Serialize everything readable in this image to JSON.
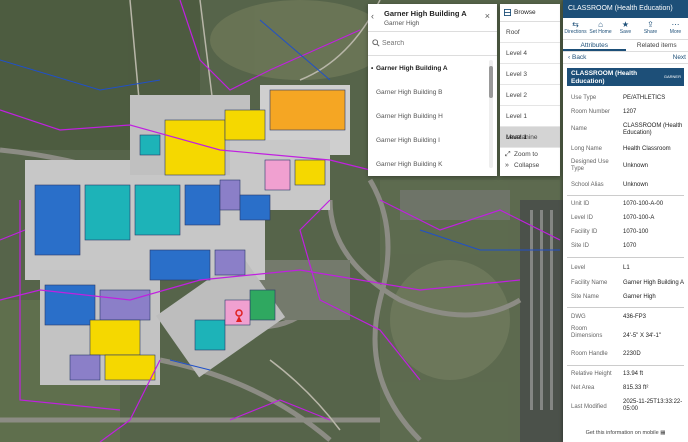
{
  "facility_picker": {
    "title": "Garner High Building A",
    "subtitle": "Garner High",
    "search_placeholder": "Search",
    "items": [
      {
        "label": "Garner High Building A",
        "selected": true
      },
      {
        "label": "Garner High Building B",
        "selected": false
      },
      {
        "label": "Garner High Building H",
        "selected": false
      },
      {
        "label": "Garner High Building I",
        "selected": false
      },
      {
        "label": "Garner High Building K",
        "selected": false
      }
    ]
  },
  "level_selector": {
    "browse_label": "Browse",
    "levels": [
      "Roof",
      "Level 4",
      "Level 3",
      "Level 2",
      "Level 1 Mezzanine",
      "Level 1"
    ],
    "active_level": "Level 1",
    "zoom_label": "Zoom to",
    "collapse_label": "Collapse"
  },
  "panel": {
    "header": "CLASSROOM (Health Education)",
    "tools": [
      {
        "icon": "directions-icon",
        "label": "Directions"
      },
      {
        "icon": "home-icon",
        "label": "Set Home"
      },
      {
        "icon": "star-icon",
        "label": "Save"
      },
      {
        "icon": "share-icon",
        "label": "Share"
      },
      {
        "icon": "more-icon",
        "label": "More"
      }
    ],
    "tabs": [
      "Attributes",
      "Related items"
    ],
    "back_label": "Back",
    "next_label": "Next",
    "feature_title": "CLASSROOM (Health Education)",
    "logo_text": "GARNER",
    "attributes_group1": [
      {
        "key": "Use Type",
        "value": "PE/ATHLETICS"
      },
      {
        "key": "Room Number",
        "value": "1207"
      },
      {
        "key": "Name",
        "value": "CLASSROOM (Health Education)"
      },
      {
        "key": "Long Name",
        "value": "Health Classroom"
      },
      {
        "key": "Designed Use Type",
        "value": "Unknown"
      },
      {
        "key": "School Alias",
        "value": "Unknown"
      }
    ],
    "attributes_group2": [
      {
        "key": "Unit ID",
        "value": "1070-100-A-00"
      },
      {
        "key": "Level ID",
        "value": "1070-100-A"
      },
      {
        "key": "Facility ID",
        "value": "1070-100"
      },
      {
        "key": "Site ID",
        "value": "1070"
      }
    ],
    "attributes_group3": [
      {
        "key": "Level",
        "value": "L1"
      },
      {
        "key": "Facility Name",
        "value": "Garner High Building A"
      },
      {
        "key": "Site Name",
        "value": "Garner High"
      }
    ],
    "attributes_group4": [
      {
        "key": "DWG",
        "value": "436-FP3"
      },
      {
        "key": "Room Dimensions",
        "value": "24'-5\" X 34'-1\""
      },
      {
        "key": "Room Handle",
        "value": "2230D"
      }
    ],
    "attributes_group5": [
      {
        "key": "Relative Height",
        "value": "13.94 ft"
      },
      {
        "key": "Net Area",
        "value": "815.33 ft²"
      },
      {
        "key": "Last Modified",
        "value": "2025-11-25T13:33:22-05:00"
      }
    ],
    "mobile_text": "Get this information on mobile"
  },
  "colors": {
    "panel_blue": "#1d4f78",
    "space_orange": "#f5a623",
    "space_yellow": "#f5d800",
    "space_blue": "#2a6fc9",
    "space_teal": "#1db3b8",
    "space_purple": "#8b7fc8",
    "space_pink": "#f0a0d0",
    "space_green": "#2fa860",
    "network_magenta": "#c020e0"
  }
}
